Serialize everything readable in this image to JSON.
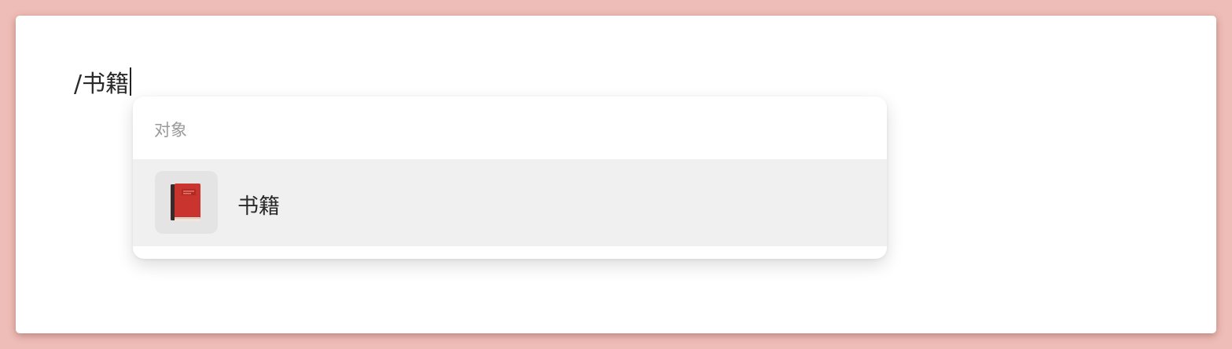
{
  "editor": {
    "text": "/书籍"
  },
  "popup": {
    "section_label": "对象",
    "items": [
      {
        "label": "书籍",
        "icon": "red-book-icon"
      }
    ]
  },
  "colors": {
    "background": "#efbdb7",
    "card": "#ffffff",
    "item_highlight": "#f0f0f0",
    "book_red": "#c9352e"
  }
}
